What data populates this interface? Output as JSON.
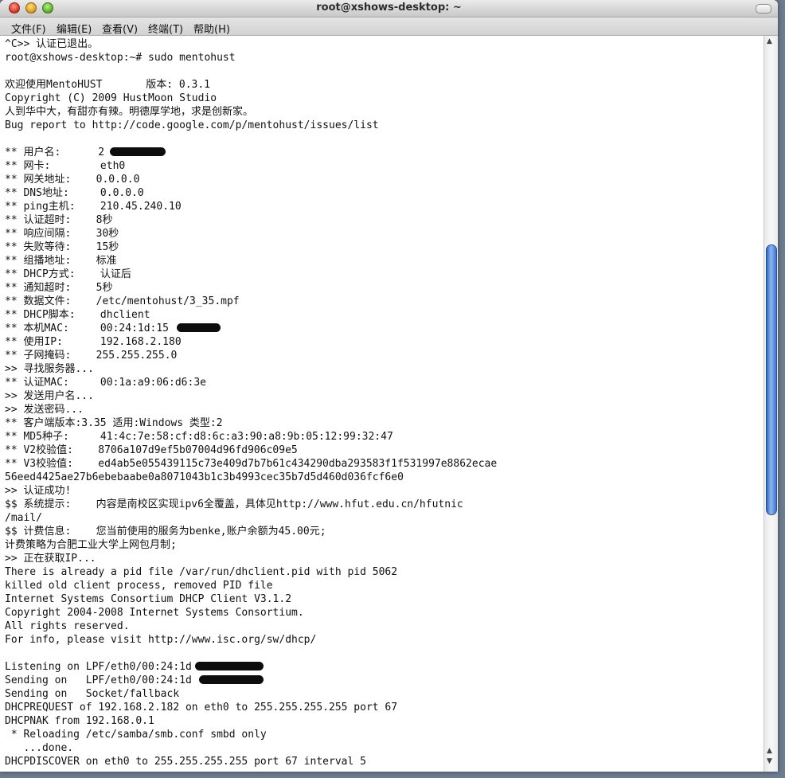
{
  "window": {
    "title": "root@xshows-desktop: ~"
  },
  "menubar": {
    "items": [
      "文件(F)",
      "编辑(E)",
      "查看(V)",
      "终端(T)",
      "帮助(H)"
    ]
  },
  "terminal": {
    "lines": [
      "^C>> 认证已退出。",
      "root@xshows-desktop:~# sudo mentohust",
      "",
      "欢迎使用MentoHUST       版本: 0.3.1",
      "Copyright (C) 2009 HustMoon Studio",
      "人到华中大，有甜亦有辣。明德厚学地，求是创新家。",
      "Bug report to http://code.google.com/p/mentohust/issues/list",
      "",
      "** 用户名:      2",
      "** 网卡:        eth0",
      "** 网关地址:    0.0.0.0",
      "** DNS地址:     0.0.0.0",
      "** ping主机:    210.45.240.10",
      "** 认证超时:    8秒",
      "** 响应间隔:    30秒",
      "** 失败等待:    15秒",
      "** 组播地址:    标准",
      "** DHCP方式:    认证后",
      "** 通知超时:    5秒",
      "** 数据文件:    /etc/mentohust/3_35.mpf",
      "** DHCP脚本:    dhclient",
      "** 本机MAC:     00:24:1d:15",
      "** 使用IP:      192.168.2.180",
      "** 子网掩码:    255.255.255.0",
      ">> 寻找服务器...",
      "** 认证MAC:     00:1a:a9:06:d6:3e",
      ">> 发送用户名...",
      ">> 发送密码...",
      "** 客户端版本:3.35 适用:Windows 类型:2",
      "** MD5种子:     41:4c:7e:58:cf:d8:6c:a3:90:a8:9b:05:12:99:32:47",
      "** V2校验值:    8706a107d9ef5b07004d96fd906c09e5",
      "** V3校验值:    ed4ab5e055439115c73e409d7b7b61c434290dba293583f1f531997e8862ecae",
      "56eed4425ae27b6ebebaabe0a8071043b1c3b4993cec35b7d5d460d036fcf6e0",
      ">> 认证成功!",
      "$$ 系统提示:    内容是南校区实现ipv6全覆盖，具体见http://www.hfut.edu.cn/hfutnic",
      "/mail/",
      "$$ 计费信息:    您当前使用的服务为benke,账户余额为45.00元;",
      "计费策略为合肥工业大学上网包月制;",
      ">> 正在获取IP...",
      "There is already a pid file /var/run/dhclient.pid with pid 5062",
      "killed old client process, removed PID file",
      "Internet Systems Consortium DHCP Client V3.1.2",
      "Copyright 2004-2008 Internet Systems Consortium.",
      "All rights reserved.",
      "For info, please visit http://www.isc.org/sw/dhcp/",
      "",
      "Listening on LPF/eth0/00:24:1d",
      "Sending on   LPF/eth0/00:24:1d",
      "Sending on   Socket/fallback",
      "DHCPREQUEST of 192.168.2.182 on eth0 to 255.255.255.255 port 67",
      "DHCPNAK from 192.168.0.1",
      " * Reloading /etc/samba/smb.conf smbd only",
      "   ...done.",
      "DHCPDISCOVER on eth0 to 255.255.255.255 port 67 interval 5"
    ]
  },
  "scrollbar": {
    "position_fraction": 0.47,
    "visible_fraction": 0.39
  }
}
